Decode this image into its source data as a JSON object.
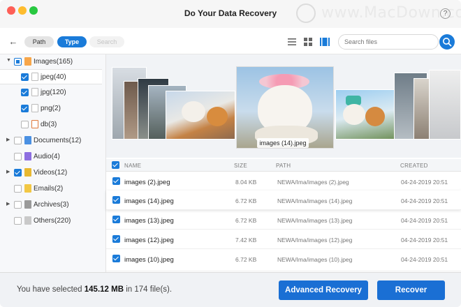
{
  "window": {
    "title": "Do Your Data Recovery",
    "watermark": "www.MacDown.com",
    "help_label": "?"
  },
  "toolbar": {
    "back_icon": "back-arrow-icon",
    "tabs": [
      {
        "label": "Path"
      },
      {
        "label": "Type"
      },
      {
        "label": "Search"
      }
    ],
    "views": [
      "list-view-icon",
      "grid-view-icon",
      "filmstrip-view-icon"
    ],
    "search_placeholder": "Search files",
    "accent": "#1a7bd9"
  },
  "sidebar": {
    "items": [
      {
        "label": "Images(165)",
        "check": "partial",
        "expanded": true
      },
      {
        "label": "jpeg(40)",
        "check": "on"
      },
      {
        "label": "jpg(120)",
        "check": "on"
      },
      {
        "label": "png(2)",
        "check": "on"
      },
      {
        "label": "db(3)",
        "check": "off"
      },
      {
        "label": "Documents(12)",
        "check": "off"
      },
      {
        "label": "Audio(4)",
        "check": "off"
      },
      {
        "label": "Videos(12)",
        "check": "on"
      },
      {
        "label": "Emails(2)",
        "check": "off"
      },
      {
        "label": "Archives(3)",
        "check": "off"
      },
      {
        "label": "Others(220)",
        "check": "off"
      }
    ]
  },
  "preview": {
    "caption": "images (14).jpeg"
  },
  "table": {
    "headers": {
      "name": "NAME",
      "size": "SIZE",
      "path": "PATH",
      "created": "CREATED"
    },
    "rows": [
      {
        "name": "images (2).jpeg",
        "size": "8.04 KB",
        "path": "NEWA/Ima/images (2).jpeg",
        "created": "04-24-2019 20:51"
      },
      {
        "name": "images (14).jpeg",
        "size": "6.72 KB",
        "path": "NEWA/Ima/images (14).jpeg",
        "created": "04-24-2019 20:51"
      },
      {
        "name": "images (13).jpeg",
        "size": "6.72 KB",
        "path": "NEWA/Ima/images (13).jpeg",
        "created": "04-24-2019 20:51"
      },
      {
        "name": "images (12).jpeg",
        "size": "7.42 KB",
        "path": "NEWA/Ima/images (12).jpeg",
        "created": "04-24-2019 20:51"
      },
      {
        "name": "images (10).jpeg",
        "size": "6.72 KB",
        "path": "NEWA/Ima/images (10).jpeg",
        "created": "04-24-2019 20:51"
      }
    ]
  },
  "footer": {
    "sel_prefix": "You have selected ",
    "sel_size": "145.12 MB",
    "sel_suffix": " in 174 file(s).",
    "advanced_label": "Advanced Recovery",
    "recover_label": "Recover"
  }
}
